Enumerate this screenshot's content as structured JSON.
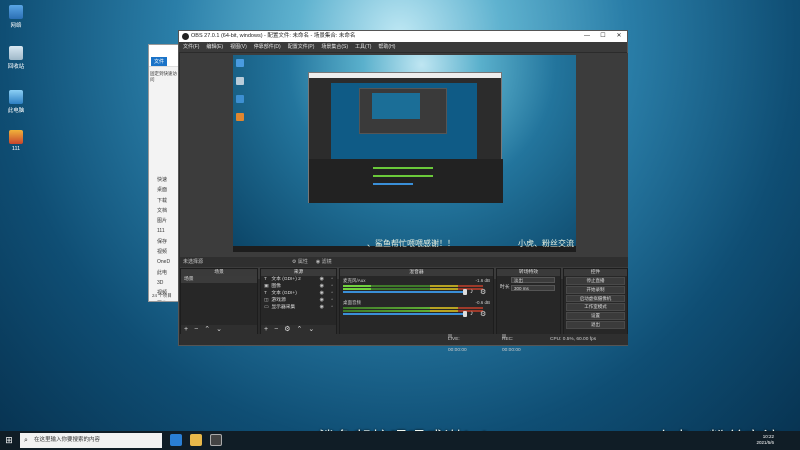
{
  "desktop": {
    "icons": [
      {
        "label": "网络",
        "icon": "network-icon"
      },
      {
        "label": "回收站",
        "icon": "recycle-bin-icon"
      },
      {
        "label": "此电脑",
        "icon": "computer-icon"
      },
      {
        "label": "111",
        "icon": "archive-icon"
      }
    ]
  },
  "explorer": {
    "tab": "文件",
    "quick_access": [
      "固定到快速访问"
    ],
    "tree": [
      "快速",
      "桌面",
      "下载",
      "文档",
      "图片",
      "111",
      "保存",
      "视频",
      "OneD",
      "此电",
      "3D",
      "视频",
      "图片",
      "文档"
    ],
    "status": "24 个项目"
  },
  "obs": {
    "title": "OBS 27.0.1 (64-bit, windows) - 配置文件: 未命名 - 场景集合: 未命名",
    "window_controls": [
      "—",
      "☐",
      "✕"
    ],
    "menu": [
      "文件(F)",
      "编辑(E)",
      "视图(V)",
      "停靠部件(D)",
      "配置文件(P)",
      "场景集合(S)",
      "工具(T)",
      "帮助(H)"
    ],
    "preview_subtitle_left": "、鲨鱼帮忙喂喂感谢！！",
    "preview_subtitle_right": "小虎、粉丝交流",
    "no_source_label": "未选择源",
    "properties_label": "属性",
    "filters_label": "滤镜",
    "docks": {
      "scenes": {
        "title": "场景",
        "items": [
          "场景"
        ]
      },
      "sources": {
        "title": "来源",
        "items": [
          {
            "type": "T",
            "name": "文本 (GDI+) 2"
          },
          {
            "type": "▣",
            "name": "图像"
          },
          {
            "type": "T",
            "name": "文本 (GDI+)"
          },
          {
            "type": "◫",
            "name": "游戏源"
          },
          {
            "type": "▭",
            "name": "显示器采集"
          }
        ]
      },
      "mixer": {
        "title": "混音器",
        "channels": [
          {
            "name": "麦克风/Aux",
            "db": "-1.6 dB"
          },
          {
            "name": "桌面音频",
            "db": "-0.6 dB"
          }
        ]
      },
      "transitions": {
        "title": "转场特效",
        "type": "淡出",
        "duration_label": "时长",
        "duration": "300 ms"
      },
      "controls": {
        "title": "控件",
        "buttons": [
          "停止直播",
          "开始录制",
          "启动虚拟摄像机",
          "工作室模式",
          "设置",
          "退出"
        ]
      }
    },
    "status": {
      "live": "LIVE: 00:00:00",
      "rec": "REC: 00:00:00",
      "cpu": "CPU: 0.5%, 60.00 fps"
    }
  },
  "overlay": {
    "subtitle_left": "、鲨鱼帮忙喂喂感谢！！",
    "subtitle_right": "小虎、粉丝交流"
  },
  "taskbar": {
    "search_placeholder": "在这里输入你要搜索的内容",
    "clock_time": "10:22",
    "clock_date": "2021/5/6"
  }
}
